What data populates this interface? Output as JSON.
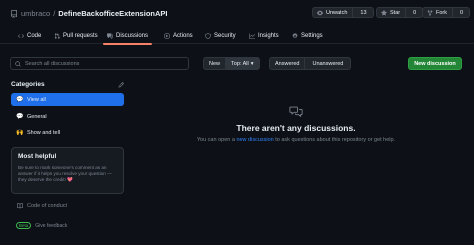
{
  "repo": {
    "owner": "umbraco",
    "slash": "/",
    "name": "DefineBackofficeExtensionAPI"
  },
  "header_buttons": {
    "watch_label": "Unwatch",
    "watch_count": "13",
    "star_label": "Star",
    "star_count": "0",
    "fork_label": "Fork",
    "fork_count": "0"
  },
  "tabs": [
    {
      "label": "Code",
      "icon": "code-icon"
    },
    {
      "label": "Pull requests",
      "icon": "pull-request-icon"
    },
    {
      "label": "Discussions",
      "icon": "discussions-icon",
      "active": true
    },
    {
      "label": "Actions",
      "icon": "play-icon"
    },
    {
      "label": "Security",
      "icon": "shield-icon"
    },
    {
      "label": "Insights",
      "icon": "graph-icon"
    },
    {
      "label": "Settings",
      "icon": "gear-icon"
    }
  ],
  "search": {
    "placeholder": "Search all discussions"
  },
  "filters": {
    "new_label": "New",
    "top_label": "Top: All",
    "answered_label": "Answered",
    "unanswered_label": "Unanswered"
  },
  "new_discussion_label": "New discussion",
  "categories": {
    "title": "Categories",
    "items": [
      {
        "label": "View all",
        "emoji": "💬",
        "active": true
      },
      {
        "label": "General",
        "emoji": "💬"
      },
      {
        "label": "Show and tell",
        "emoji": "🙌"
      }
    ]
  },
  "most_helpful": {
    "title": "Most helpful",
    "text": "Be sure to mark someone's comment as an answer if it helps you resolve your question — they deserve the credit! 💖"
  },
  "code_of_conduct_label": "Code of conduct",
  "feedback": {
    "beta": "Beta",
    "label": "Give feedback"
  },
  "empty_state": {
    "title": "There aren't any discussions.",
    "before": "You can open a ",
    "link": "new discussion",
    "after": " to ask questions about this repository or get help."
  },
  "colors": {
    "background": "#0d1117",
    "accent_blue": "#1f6feb",
    "primary_green": "#238636",
    "tab_underline": "#f78166"
  }
}
